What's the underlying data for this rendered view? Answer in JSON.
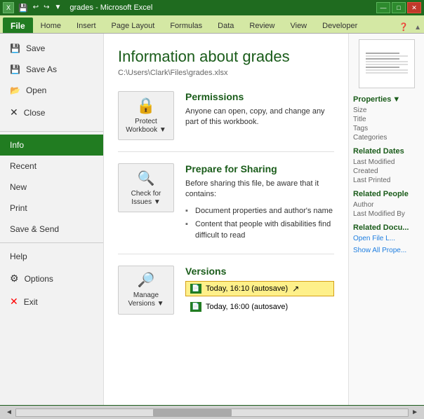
{
  "app": {
    "title": "grades - Microsoft Excel",
    "file_name": "grades"
  },
  "title_bar": {
    "text": "grades - Microsoft Excel",
    "min": "—",
    "max": "□",
    "close": "✕"
  },
  "quick_access": {
    "save_icon": "💾",
    "undo_icon": "↩",
    "redo_icon": "↪"
  },
  "ribbon_tabs": {
    "file": "File",
    "home": "Home",
    "insert": "Insert",
    "page_layout": "Page Layout",
    "formulas": "Formulas",
    "data": "Data",
    "review": "Review",
    "view": "View",
    "developer": "Developer"
  },
  "sidebar": {
    "items": [
      {
        "id": "save",
        "label": "Save",
        "icon": "💾",
        "active": false
      },
      {
        "id": "save-as",
        "label": "Save As",
        "icon": "💾",
        "active": false
      },
      {
        "id": "open",
        "label": "Open",
        "icon": "📂",
        "active": false
      },
      {
        "id": "close",
        "label": "Close",
        "icon": "✕",
        "active": false
      }
    ],
    "info_label": "Info",
    "recent_label": "Recent",
    "new_label": "New",
    "print_label": "Print",
    "save_send_label": "Save & Send",
    "help_label": "Help",
    "options_label": "Options",
    "exit_label": "Exit"
  },
  "content": {
    "title": "Information about grades",
    "path": "C:\\Users\\Clark\\Files\\grades.xlsx",
    "sections": {
      "permissions": {
        "title": "Permissions",
        "button_label": "Protect\nWorkbook",
        "description": "Anyone can open, copy, and change any part of this workbook.",
        "dropdown": "▼"
      },
      "sharing": {
        "title": "Prepare for Sharing",
        "button_label": "Check for\nIssues",
        "description": "Before sharing this file, be aware that it contains:",
        "items": [
          "Document properties and author's name",
          "Content that people with disabilities find difficult to read"
        ],
        "dropdown": "▼"
      },
      "versions": {
        "title": "Versions",
        "button_label": "Manage\nVersions",
        "dropdown": "▼",
        "items": [
          {
            "label": "Today, 16:10 (autosave)",
            "highlighted": true
          },
          {
            "label": "Today, 16:00 (autosave)",
            "highlighted": false
          }
        ],
        "cursor": "↗"
      }
    }
  },
  "right_panel": {
    "properties_label": "Properties",
    "properties_dropdown": "▼",
    "size_label": "Size",
    "size_value": "",
    "title_label": "Title",
    "title_value": "",
    "tags_label": "Tags",
    "tags_value": "",
    "categories_label": "Categories",
    "categories_value": "",
    "related_dates_label": "Related Dates",
    "last_modified_label": "Last Modified",
    "last_modified_value": "",
    "created_label": "Created",
    "created_value": "",
    "last_printed_label": "Last Printed",
    "last_printed_value": "",
    "related_people_label": "Related People",
    "author_label": "Author",
    "author_value": "",
    "last_modified_by_label": "Last Modified By",
    "last_modified_by_value": "",
    "related_docs_label": "Related Docu...",
    "open_file_label": "Open File L...",
    "show_all_label": "Show All Prope..."
  },
  "status_bar": {
    "left_arrow": "◄",
    "right_arrow": "►"
  }
}
